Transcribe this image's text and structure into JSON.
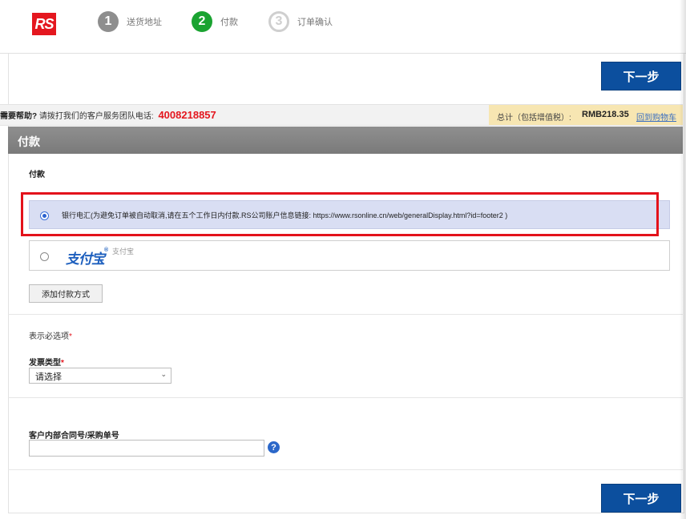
{
  "header": {
    "logo_text": "RS",
    "steps": [
      {
        "number": "1",
        "label": "送货地址",
        "state": "done"
      },
      {
        "number": "2",
        "label": "付款",
        "state": "active"
      },
      {
        "number": "3",
        "label": "订单确认",
        "state": "pending"
      }
    ]
  },
  "buttons": {
    "next_top": "下一步",
    "next_bottom": "下一步",
    "add_payment": "添加付款方式"
  },
  "help_bar": {
    "lead": "需要帮助?",
    "text": "请拨打我们的客户服务团队电话:",
    "phone": "4008218857"
  },
  "total": {
    "label": "总计（包括增值税）:",
    "amount": "RMB218.35",
    "back_link": "回到购物车"
  },
  "section": {
    "title": "付款",
    "payment_label": "付款"
  },
  "payment_options": {
    "bank_transfer": "银行电汇(为避免订单被自动取消,请在五个工作日内付款.RS公司账户信息链接: https://www.rsonline.cn/web/generalDisplay.html?id=footer2 )",
    "alipay_logo": "支付宝",
    "alipay_label": "支付宝"
  },
  "form": {
    "required_note": "表示必选项",
    "required_mark": "*",
    "invoice_type_label": "发票类型",
    "invoice_type_value": "请选择",
    "po_label": "客户内部合同号/采购单号",
    "po_value": ""
  },
  "colors": {
    "brand_red": "#e4171f",
    "step_active": "#1aa331",
    "primary_blue": "#0c4f9e",
    "highlight_outline": "#e3121b"
  }
}
